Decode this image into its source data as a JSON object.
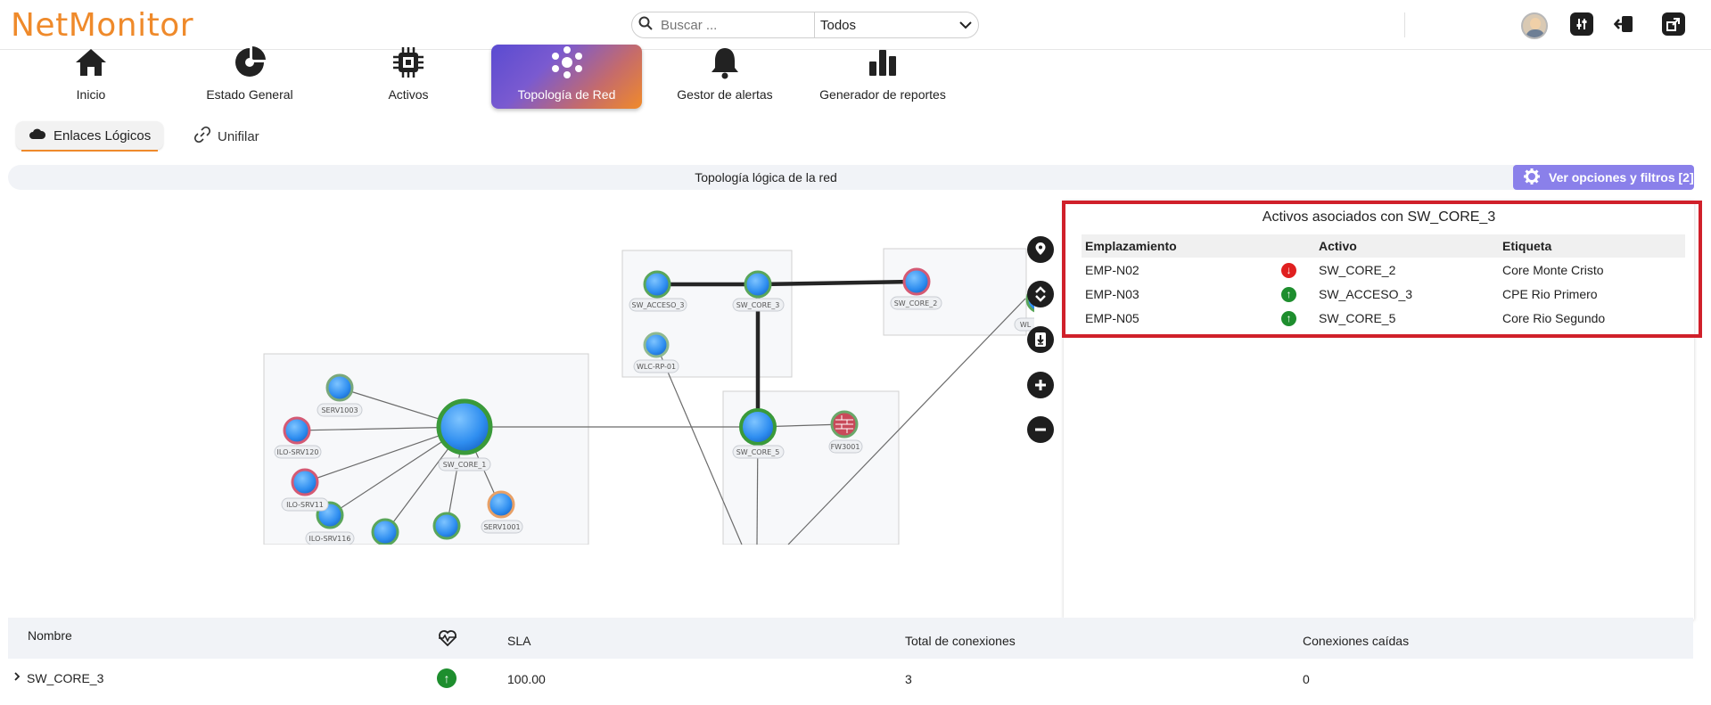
{
  "app": {
    "logo": "NetMonitor"
  },
  "search": {
    "placeholder": "Buscar ...",
    "filter_value": "Todos"
  },
  "nav": {
    "items": [
      {
        "label": "Inicio",
        "icon": "home-icon"
      },
      {
        "label": "Estado General",
        "icon": "gauge-icon"
      },
      {
        "label": "Activos",
        "icon": "chip-icon"
      },
      {
        "label": "Topología de Red",
        "icon": "network-icon",
        "active": true
      },
      {
        "label": "Gestor de alertas",
        "icon": "bell-icon"
      },
      {
        "label": "Generador de reportes",
        "icon": "bar-chart-icon"
      }
    ]
  },
  "subtabs": {
    "logical": "Enlaces Lógicos",
    "unifilar": "Unifilar"
  },
  "topology": {
    "title": "Topología lógica de la red",
    "options_button": "Ver opciones y filtros [2]",
    "node_labels": {
      "sw_acceso_3": "SW_ACCESO_3",
      "sw_core_3": "SW_CORE_3",
      "sw_core_2": "SW_CORE_2",
      "wlc_rp_01": "WLC-RP-01",
      "serv1003": "SERV1003",
      "ilo_srv120": "ILO-SRV120",
      "sw_core_1": "SW_CORE_1",
      "ilo_srv11x": "ILO-SRV11",
      "ilo_srv116": "ILO-SRV116",
      "serv1001": "SERV1001",
      "sw_core_5": "SW_CORE_5",
      "fw3001": "FW3001",
      "wl_partial": "WL"
    }
  },
  "panel": {
    "title": "Activos asociados con SW_CORE_3",
    "headers": {
      "location": "Emplazamiento",
      "asset": "Activo",
      "tag": "Etiqueta"
    },
    "rows": [
      {
        "location": "EMP-N02",
        "status": "down",
        "asset": "SW_CORE_2",
        "tag": "Core Monte Cristo"
      },
      {
        "location": "EMP-N03",
        "status": "up",
        "asset": "SW_ACCESO_3",
        "tag": "CPE Rio Primero"
      },
      {
        "location": "EMP-N05",
        "status": "up",
        "asset": "SW_CORE_5",
        "tag": "Core Rio Segundo"
      }
    ]
  },
  "bottom_table": {
    "headers": {
      "name": "Nombre",
      "sla": "SLA",
      "total": "Total de conexiones",
      "down": "Conexiones caídas"
    },
    "row": {
      "name": "SW_CORE_3",
      "status": "up",
      "sla": "100.00",
      "total": "3",
      "down": "0"
    }
  },
  "colors": {
    "brand": "#ef8a2b",
    "accent": "#8a80ea",
    "up": "#1e8e2e",
    "down": "#e02020",
    "highlight": "#d0202a"
  }
}
